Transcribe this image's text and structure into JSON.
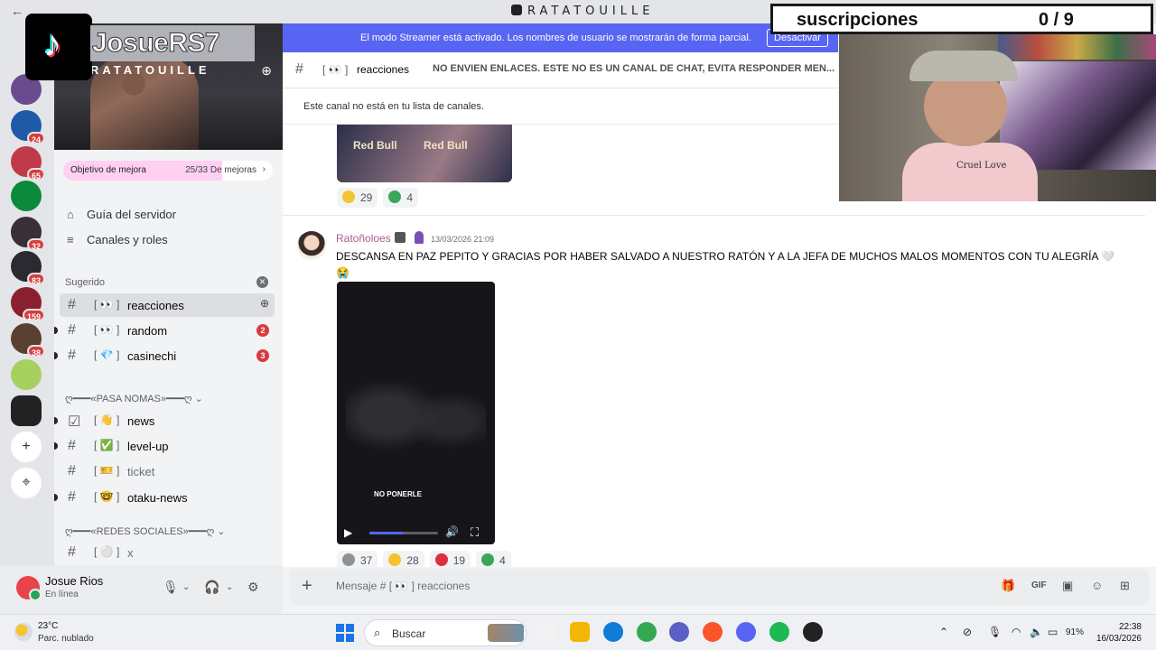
{
  "window": {
    "title": "RATATOUILLE",
    "back_label": "←"
  },
  "overlay": {
    "tiktok_name": "JosueRS7",
    "subs_label": "suscripciones",
    "subs_count": "0 / 9",
    "shirt_text": "Cruel Love"
  },
  "rail": {
    "servers": [
      {
        "color": "#6b4b8f",
        "badge": ""
      },
      {
        "color": "#1e5aa8",
        "badge": "24"
      },
      {
        "color": "#c03a4a",
        "badge": "65"
      },
      {
        "color": "#0a8a3a",
        "badge": ""
      },
      {
        "color": "#3a2f38",
        "badge": "32"
      },
      {
        "color": "#2a2a30",
        "badge": "83"
      },
      {
        "color": "#8a2030",
        "badge": "159"
      },
      {
        "color": "#5a4030",
        "badge": "38"
      },
      {
        "color": "#a8d060",
        "badge": ""
      },
      {
        "color": "#222222",
        "badge": ""
      }
    ],
    "add_server_icon": "+",
    "discover_icon": "⌖"
  },
  "sidebar": {
    "server_name": "RATATOUILLE",
    "boost": {
      "label": "Objetivo de mejora",
      "count": "25/33 De mejoras",
      "progress": 0.76
    },
    "links": [
      {
        "icon": "⌂",
        "label": "Guía del servidor"
      },
      {
        "icon": "≡",
        "label": "Canales y roles"
      }
    ],
    "suggested_label": "Sugerido",
    "channels_top": [
      {
        "tag": "[ 👀 ]",
        "name": "reacciones",
        "badge": "",
        "active": true
      },
      {
        "tag": "[ 👀 ]",
        "name": "random",
        "badge": "2",
        "active": false
      },
      {
        "tag": "[ 💎 ]",
        "name": "casinechi",
        "badge": "3",
        "active": false
      }
    ],
    "category1": "ღ━━━«PASA NOMAS»━━━ღ ⌄",
    "channels_mid": [
      {
        "tag": "[ 👋 ]",
        "name": "news",
        "muted": false
      },
      {
        "tag": "[ ✅ ]",
        "name": "level-up",
        "muted": false
      },
      {
        "tag": "[ 🎫 ]",
        "name": "ticket",
        "muted": true
      },
      {
        "tag": "[ 🤓 ]",
        "name": "otaku-news",
        "muted": false
      }
    ],
    "category2": "ღ━━━«REDES SOCIALES»━━━ღ ⌄",
    "channels_bottom": [
      {
        "tag": "[ ⚪ ]",
        "name": "x",
        "muted": true
      }
    ]
  },
  "user": {
    "name": "Josue Rios",
    "status": "En línea"
  },
  "streamer": {
    "message": "El modo Streamer está activado. Los nombres de usuario se mostrarán de forma parcial.",
    "button": "Desactivar"
  },
  "channel_header": {
    "tag": "[ 👀 ]",
    "name": "reacciones",
    "topic": "NO ENVIEN ENLACES. ESTE NO ES UN CANAL DE CHAT, EVITA RESPONDER MEN..."
  },
  "notice": "Este canal no está en tu lista de canales.",
  "prev_message": {
    "reactions": [
      {
        "emoji_color": "#f4c430",
        "count": "29"
      },
      {
        "emoji_color": "#3ba55c",
        "count": "4"
      }
    ]
  },
  "message": {
    "author": "Ratoñoloes",
    "timestamp": "13/03/2026 21:09",
    "text": "DESCANSA EN PAZ PEPITO Y GRACIAS POR HABER SALVADO A NUESTRO RATÓN Y A LA JEFA DE MUCHOS MALOS MOMENTOS CON TU ALEGRÍA 🤍 😭",
    "video_caption": "NO PONERLE",
    "video_progress": 0.5,
    "reactions": [
      {
        "emoji_color": "#8e9297",
        "count": "37"
      },
      {
        "emoji_color": "#f4c430",
        "count": "28"
      },
      {
        "emoji_color": "#dd2e44",
        "count": "19"
      },
      {
        "emoji_color": "#3ba55c",
        "count": "4"
      }
    ]
  },
  "composer": {
    "placeholder": "Mensaje # [ 👀 ] reacciones"
  },
  "taskbar": {
    "temperature": "23°C",
    "weather": "Parc. nublado",
    "search_placeholder": "Buscar",
    "battery": "91%",
    "time": "22:38",
    "date": "16/03/2026",
    "apps": [
      "#f2f2f2",
      "#f2b705",
      "#0f7dd6",
      "#34a853",
      "#5b5fc7",
      "#fb542b",
      "#5865f2",
      "#1db954",
      "#222222"
    ]
  }
}
